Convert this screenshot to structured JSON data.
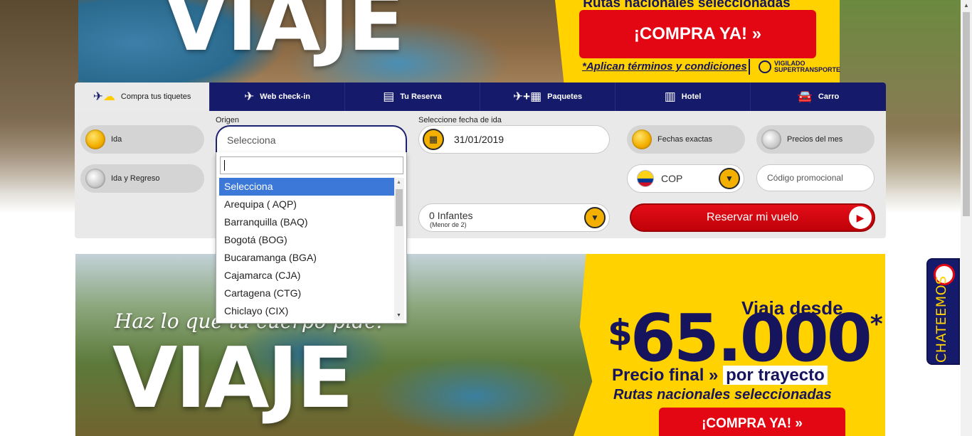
{
  "hero": {
    "word": "VIAJE",
    "subtitle": "Rutas nacionales seleccionadas",
    "cta_label": "¡COMPRA YA!  »",
    "terms": "*Aplican términos y condiciones",
    "seal_text": "VIGILADO SUPERTRANSPORTE"
  },
  "tabs": [
    {
      "label": "Compra tus tiquetes",
      "icon": "plane-sun-icon"
    },
    {
      "label": "Web check-in",
      "icon": "plane-cloud-icon"
    },
    {
      "label": "Tu Reserva",
      "icon": "reservation-icon"
    },
    {
      "label": "Paquetes",
      "icon": "plane-hotel-icon"
    },
    {
      "label": "Hotel",
      "icon": "building-icon"
    },
    {
      "label": "Carro",
      "icon": "car-icon"
    }
  ],
  "form": {
    "trip_one_way": "Ida",
    "trip_round": "Ida y Regreso",
    "origin_label": "Origen",
    "origin_value": "Selecciona",
    "date_label": "Seleccione fecha de ida",
    "date_value": "31/01/2019",
    "exact_dates": "Fechas exactas",
    "month_prices": "Precios del mes",
    "currency": "COP",
    "promo_placeholder": "Código promocional",
    "infants_main": "0 Infantes",
    "infants_sub": "(Menor de 2)",
    "reserve_label": "Reservar mi vuelo"
  },
  "dropdown": {
    "search_value": "",
    "options": [
      "Selecciona",
      "Arequipa ( AQP)",
      "Barranquilla (BAQ)",
      "Bogotá (BOG)",
      "Bucaramanga (BGA)",
      "Cajamarca (CJA)",
      "Cartagena (CTG)",
      "Chiclayo (CIX)"
    ],
    "selected_index": 0
  },
  "promo": {
    "tagline": "Haz lo que tu cuerpo pide:",
    "word": "VIAJE",
    "from_label": "Viaja desde",
    "price_currency": "$",
    "price_value": "65.000",
    "price_asterisk": "*",
    "final_prefix": "Precio final »",
    "final_boxed": "por trayecto",
    "routes": "Rutas nacionales seleccionadas",
    "cta_label": "¡COMPRA YA!  »"
  },
  "chat": {
    "label": "CHATEEMOS"
  },
  "colors": {
    "navy": "#151a6b",
    "yellow": "#ffd200",
    "red": "#e30613",
    "orange": "#f3b000"
  }
}
